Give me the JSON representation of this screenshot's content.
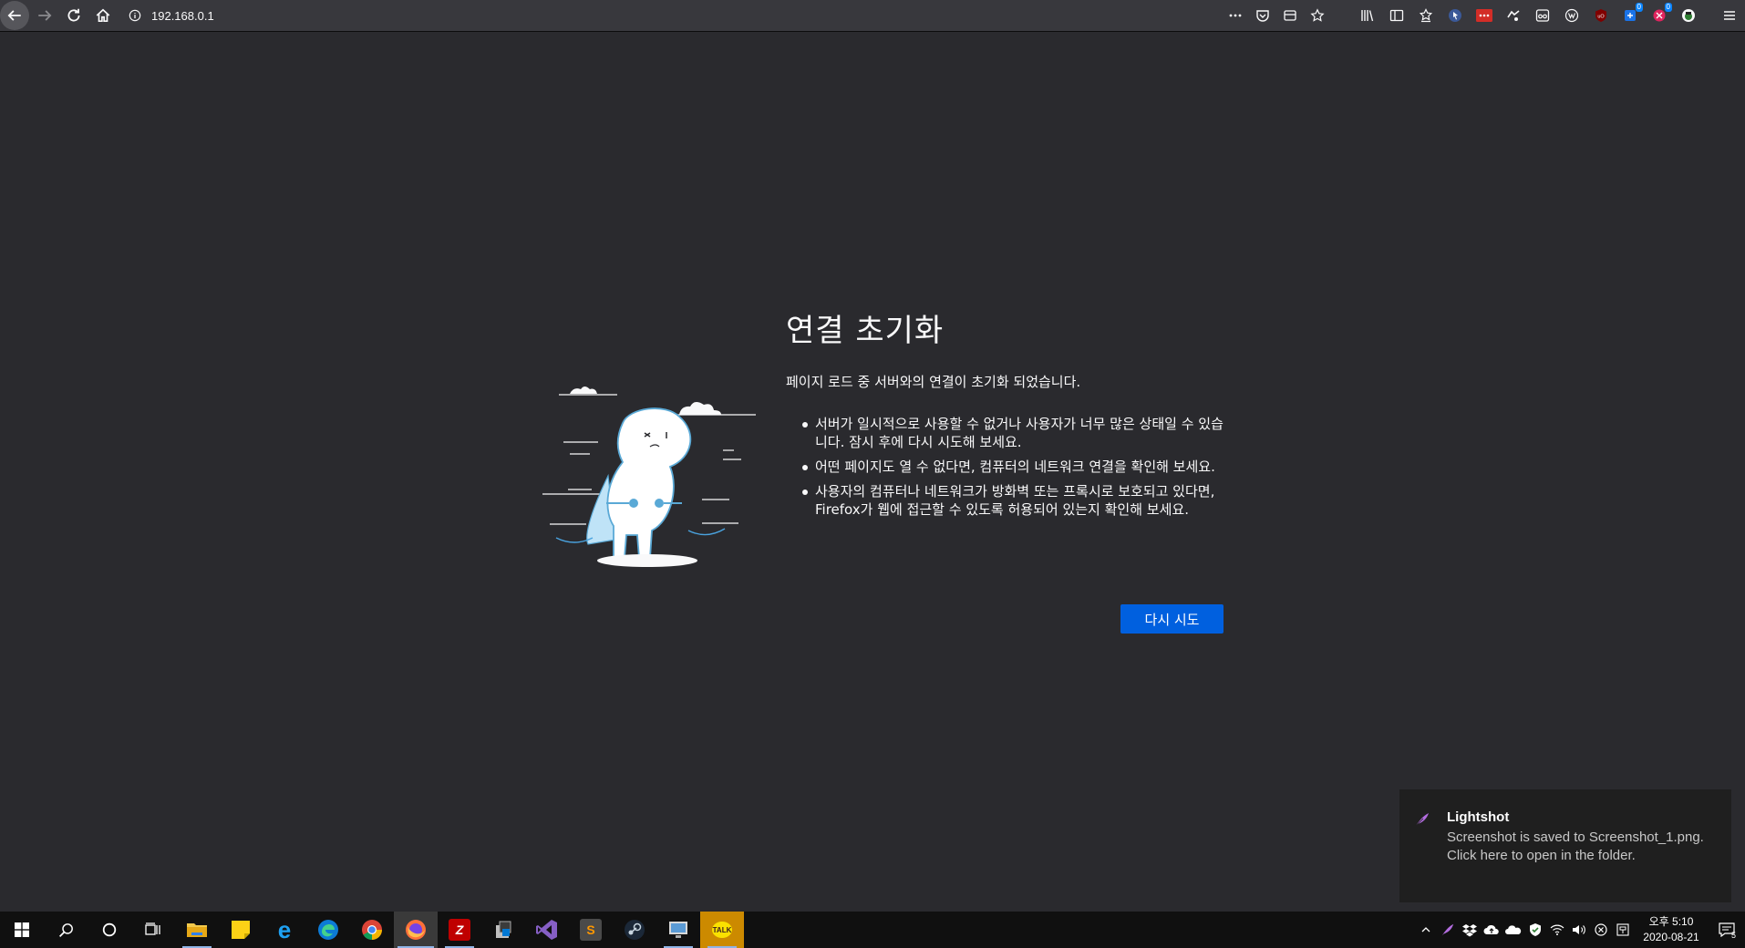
{
  "browser": {
    "url": "192.168.0.1",
    "extension_badges": [
      "0",
      "0"
    ]
  },
  "error_page": {
    "title": "연결 초기화",
    "lead": "페이지 로드 중 서버와의 연결이 초기화 되었습니다.",
    "bullets": [
      "서버가 일시적으로 사용할 수 없거나 사용자가 너무 많은 상태일 수 있습니다. 잠시 후에 다시 시도해 보세요.",
      "어떤 페이지도 열 수 없다면, 컴퓨터의 네트워크 연결을 확인해 보세요.",
      "사용자의 컴퓨터나 네트워크가 방화벽 또는 프록시로 보호되고 있다면, Firefox가 웹에 접근할 수 있도록 허용되어 있는지 확인해 보세요."
    ],
    "retry_label": "다시 시도"
  },
  "toast": {
    "title": "Lightshot",
    "message": "Screenshot is saved to Screenshot_1.png. Click here to open in the folder."
  },
  "taskbar": {
    "apps": [
      {
        "name": "file-explorer",
        "glyph": ""
      },
      {
        "name": "sticky-notes",
        "glyph": ""
      },
      {
        "name": "internet-explorer",
        "glyph": "e"
      },
      {
        "name": "edge",
        "glyph": ""
      },
      {
        "name": "chrome",
        "glyph": ""
      },
      {
        "name": "firefox",
        "glyph": ""
      },
      {
        "name": "filezilla",
        "glyph": "Z"
      },
      {
        "name": "app-store",
        "glyph": ""
      },
      {
        "name": "visual-studio",
        "glyph": ""
      },
      {
        "name": "sublime-text",
        "glyph": "S"
      },
      {
        "name": "steam",
        "glyph": ""
      },
      {
        "name": "remote-desktop",
        "glyph": ""
      },
      {
        "name": "kakaotalk",
        "glyph": "TALK"
      }
    ],
    "clock_time": "오후 5:10",
    "clock_date": "2020-08-21",
    "notification_count": "5"
  },
  "colors": {
    "page_bg": "#2a2a2e",
    "toolbar_bg": "#38383d",
    "primary_button": "#0060df",
    "taskbar_bg": "#101010"
  }
}
